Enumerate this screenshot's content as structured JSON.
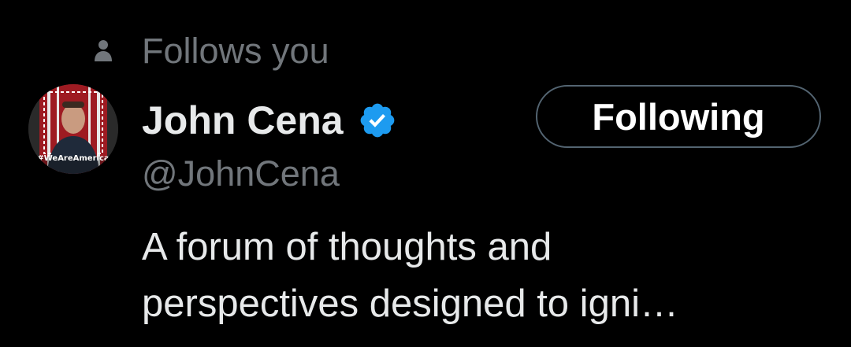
{
  "social_context": {
    "text": "Follows you",
    "icon": "person-icon"
  },
  "profile": {
    "display_name": "John Cena",
    "verified": true,
    "verified_icon": "verified-badge-icon",
    "handle": "@JohnCena",
    "avatar_overlay_text": "#WeAreAmerica",
    "bio_lines": [
      "A forum of thoughts and",
      "perspectives designed to igni…"
    ]
  },
  "actions": {
    "follow_button_label": "Following"
  },
  "colors": {
    "background": "#000000",
    "primary_text": "#e7e9ea",
    "secondary_text": "#71767b",
    "button_border": "#536471",
    "verified_blue": "#1d9bf0"
  }
}
